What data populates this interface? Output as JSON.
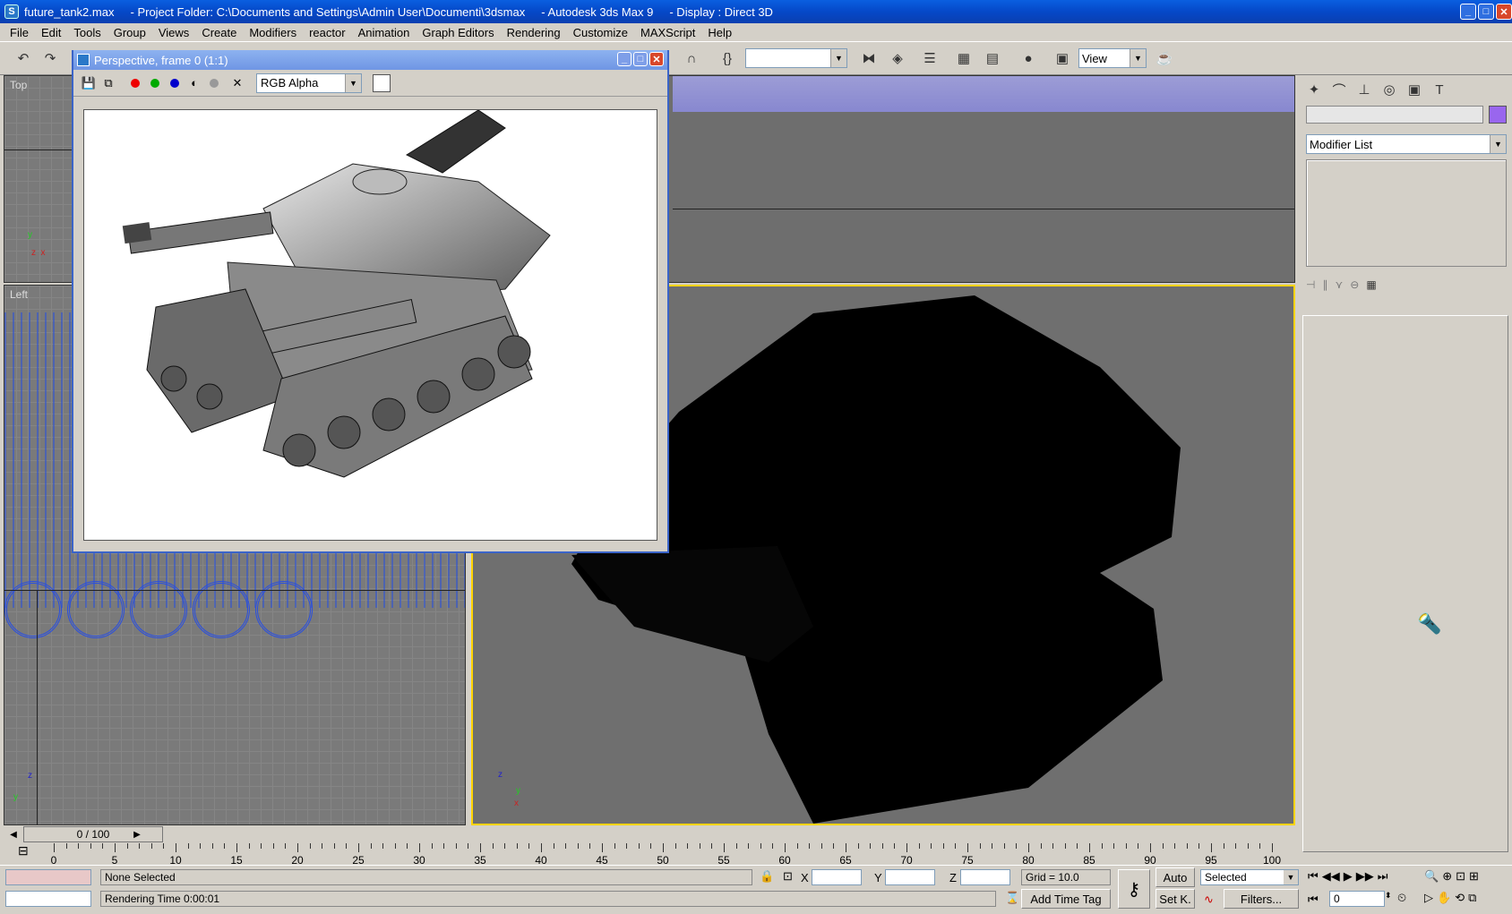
{
  "window": {
    "title": "future_tank2.max     - Project Folder: C:\\Documents and Settings\\Admin User\\Documenti\\3dsmax     - Autodesk 3ds Max 9     - Display : Direct 3D"
  },
  "menu": [
    "File",
    "Edit",
    "Tools",
    "Group",
    "Views",
    "Create",
    "Modifiers",
    "reactor",
    "Animation",
    "Graph Editors",
    "Rendering",
    "Customize",
    "MAXScript",
    "Help"
  ],
  "toolbar": {
    "reference_coord": "View",
    "named_selection": ""
  },
  "viewports": {
    "top_label": "Top",
    "left_label": "Left"
  },
  "render_window": {
    "title": "Perspective, frame 0 (1:1)",
    "channel": "RGB Alpha"
  },
  "command_panel": {
    "modifier_list": "Modifier List",
    "object_color": "#9966ee"
  },
  "time_slider": {
    "label": "0 / 100",
    "ticks": [
      "0",
      "5",
      "10",
      "15",
      "20",
      "25",
      "30",
      "35",
      "40",
      "45",
      "50",
      "55",
      "60",
      "65",
      "70",
      "75",
      "80",
      "85",
      "90",
      "95",
      "100"
    ]
  },
  "status": {
    "selection": "None Selected",
    "prompt": "Rendering Time  0:00:01",
    "x_label": "X",
    "y_label": "Y",
    "z_label": "Z",
    "grid": "Grid = 10.0",
    "auto_key": "Auto",
    "set_key": "Set K.",
    "key_filter": "Selected",
    "filters": "Filters...",
    "add_time_tag": "Add Time Tag",
    "frame": "0"
  }
}
